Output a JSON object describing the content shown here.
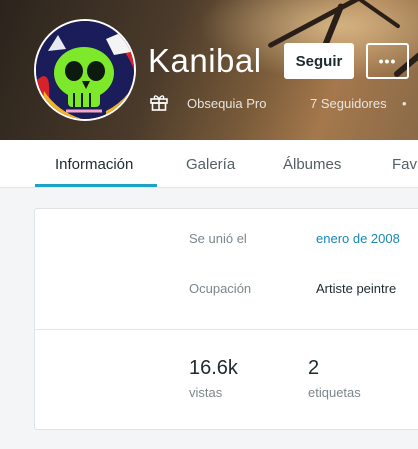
{
  "profile": {
    "username": "Kanibal",
    "follow_label": "Seguir",
    "more_label": "•••",
    "membership": "Obsequia Pro",
    "followers": "7 Seguidores",
    "separator": "•"
  },
  "tabs": [
    {
      "label": "Información",
      "active": true
    },
    {
      "label": "Galería",
      "active": false
    },
    {
      "label": "Álbumes",
      "active": false
    },
    {
      "label": "Fav",
      "active": false
    }
  ],
  "info": {
    "joined_label": "Se unió el",
    "joined_value": "enero de 2008",
    "occupation_label": "Ocupación",
    "occupation_value": "Artiste peintre"
  },
  "stats": {
    "views_count": "16.6k",
    "views_label": "vistas",
    "tags_count": "2",
    "tags_label": "etiquetas"
  },
  "colors": {
    "accent": "#1da3c8",
    "link": "#1b87b3",
    "avatar_skull": "#7ee82a"
  },
  "icons": {
    "gift": "gift-icon",
    "more": "more-options-icon"
  }
}
